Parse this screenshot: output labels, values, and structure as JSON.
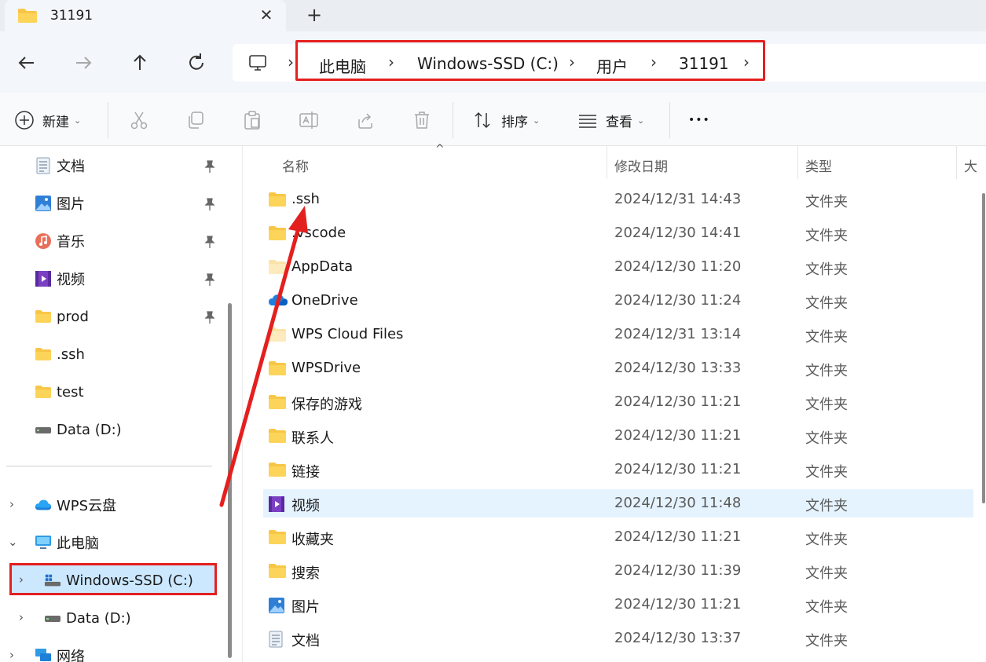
{
  "window": {
    "tab_title": "31191",
    "close_symbol": "✕",
    "newtab_symbol": "+"
  },
  "address": {
    "crumbs": [
      "此电脑",
      "Windows-SSD (C:)",
      "用户",
      "31191"
    ]
  },
  "toolbar": {
    "new_label": "新建",
    "sort_label": "排序",
    "view_label": "查看",
    "more_label": "•••"
  },
  "sidebar": {
    "quick_access": [
      {
        "label": "文档",
        "icon": "document-icon",
        "pinned": true
      },
      {
        "label": "图片",
        "icon": "pictures-icon",
        "pinned": true
      },
      {
        "label": "音乐",
        "icon": "music-icon",
        "pinned": true
      },
      {
        "label": "视频",
        "icon": "videos-icon",
        "pinned": true
      },
      {
        "label": "prod",
        "icon": "folder-icon",
        "pinned": true
      },
      {
        "label": ".ssh",
        "icon": "folder-icon",
        "pinned": false
      },
      {
        "label": "test",
        "icon": "folder-icon",
        "pinned": false
      },
      {
        "label": "Data (D:)",
        "icon": "drive-icon",
        "pinned": false
      }
    ],
    "tree": {
      "wps_cloud": "WPS云盘",
      "this_pc": "此电脑",
      "c_drive": "Windows-SSD (C:)",
      "d_drive": "Data (D:)",
      "network": "网络"
    }
  },
  "columns": {
    "name": "名称",
    "modified": "修改日期",
    "type": "类型",
    "size": "大"
  },
  "files": [
    {
      "name": ".ssh",
      "date": "2024/12/31 14:43",
      "type": "文件夹",
      "icon": "folder-icon"
    },
    {
      "name": ".vscode",
      "date": "2024/12/30 14:41",
      "type": "文件夹",
      "icon": "folder-icon"
    },
    {
      "name": "AppData",
      "date": "2024/12/30 11:20",
      "type": "文件夹",
      "icon": "folder-hidden-icon"
    },
    {
      "name": "OneDrive",
      "date": "2024/12/30 11:24",
      "type": "文件夹",
      "icon": "onedrive-icon"
    },
    {
      "name": "WPS Cloud Files",
      "date": "2024/12/31 13:14",
      "type": "文件夹",
      "icon": "folder-hidden-icon"
    },
    {
      "name": "WPSDrive",
      "date": "2024/12/30 13:33",
      "type": "文件夹",
      "icon": "folder-icon"
    },
    {
      "name": "保存的游戏",
      "date": "2024/12/30 11:21",
      "type": "文件夹",
      "icon": "folder-icon"
    },
    {
      "name": "联系人",
      "date": "2024/12/30 11:21",
      "type": "文件夹",
      "icon": "folder-icon"
    },
    {
      "name": "链接",
      "date": "2024/12/30 11:21",
      "type": "文件夹",
      "icon": "folder-icon"
    },
    {
      "name": "视频",
      "date": "2024/12/30 11:48",
      "type": "文件夹",
      "icon": "videos-icon",
      "selected": true
    },
    {
      "name": "收藏夹",
      "date": "2024/12/30 11:21",
      "type": "文件夹",
      "icon": "folder-icon"
    },
    {
      "name": "搜索",
      "date": "2024/12/30 11:39",
      "type": "文件夹",
      "icon": "folder-icon"
    },
    {
      "name": "图片",
      "date": "2024/12/30 11:21",
      "type": "文件夹",
      "icon": "pictures-icon"
    },
    {
      "name": "文档",
      "date": "2024/12/30 13:37",
      "type": "文件夹",
      "icon": "document-icon"
    }
  ],
  "colors": {
    "annotation_red": "#e4201f",
    "selection": "#cce8ff",
    "row_hover": "#e5f3ff",
    "folder_yellow": "#f8c646"
  }
}
